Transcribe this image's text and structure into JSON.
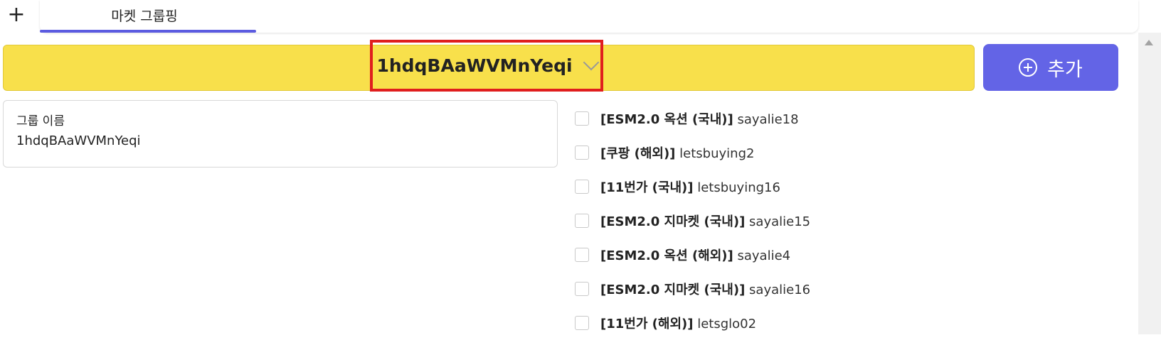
{
  "tabs": {
    "add_tab_symbol": "+",
    "active_label": "마켓 그룹핑"
  },
  "group_selector": {
    "selected": "1hdqBAaWVMnYeqi",
    "chevron_icon": "chevron-down-icon"
  },
  "add_button": {
    "label": "추가",
    "icon": "plus-circle-icon"
  },
  "group_name_card": {
    "label": "그룹 이름",
    "value": "1hdqBAaWVMnYeqi"
  },
  "markets": [
    {
      "name": "[ESM2.0 옥션 (국내)]",
      "account": "sayalie18",
      "checked": false
    },
    {
      "name": "[쿠팡 (해외)]",
      "account": "letsbuying2",
      "checked": false
    },
    {
      "name": "[11번가 (국내)]",
      "account": "letsbuying16",
      "checked": false
    },
    {
      "name": "[ESM2.0 지마켓 (국내)]",
      "account": "sayalie15",
      "checked": false
    },
    {
      "name": "[ESM2.0 옥션 (해외)]",
      "account": "sayalie4",
      "checked": false
    },
    {
      "name": "[ESM2.0 지마켓 (국내)]",
      "account": "sayalie16",
      "checked": false
    },
    {
      "name": "[11번가 (해외)]",
      "account": "letsglo02",
      "checked": false
    }
  ],
  "colors": {
    "group_bar": "#f8e04b",
    "accent": "#6364e6",
    "highlight_border": "#e01e1e"
  }
}
